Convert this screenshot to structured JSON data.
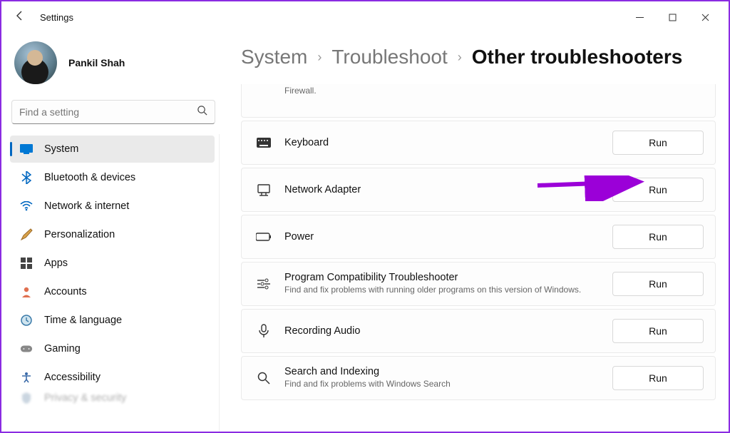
{
  "window": {
    "title": "Settings"
  },
  "profile": {
    "name": "Pankil Shah"
  },
  "search": {
    "placeholder": "Find a setting"
  },
  "sidebar": {
    "items": [
      {
        "label": "System",
        "icon": "system",
        "active": true
      },
      {
        "label": "Bluetooth & devices",
        "icon": "bluetooth"
      },
      {
        "label": "Network & internet",
        "icon": "wifi"
      },
      {
        "label": "Personalization",
        "icon": "brush"
      },
      {
        "label": "Apps",
        "icon": "apps"
      },
      {
        "label": "Accounts",
        "icon": "account"
      },
      {
        "label": "Time & language",
        "icon": "time"
      },
      {
        "label": "Gaming",
        "icon": "gaming"
      },
      {
        "label": "Accessibility",
        "icon": "accessibility"
      },
      {
        "label": "Privacy & security",
        "icon": "privacy"
      }
    ]
  },
  "breadcrumb": {
    "a": "System",
    "b": "Troubleshoot",
    "c": "Other troubleshooters"
  },
  "troubleshooters": {
    "partial_desc": "Firewall.",
    "run_label": "Run",
    "items": [
      {
        "title": "Keyboard",
        "desc": "",
        "icon": "keyboard"
      },
      {
        "title": "Network Adapter",
        "desc": "",
        "icon": "netadapter"
      },
      {
        "title": "Power",
        "desc": "",
        "icon": "power"
      },
      {
        "title": "Program Compatibility Troubleshooter",
        "desc": "Find and fix problems with running older programs on this version of Windows.",
        "icon": "compat"
      },
      {
        "title": "Recording Audio",
        "desc": "",
        "icon": "mic"
      },
      {
        "title": "Search and Indexing",
        "desc": "Find and fix problems with Windows Search",
        "icon": "search"
      }
    ]
  }
}
